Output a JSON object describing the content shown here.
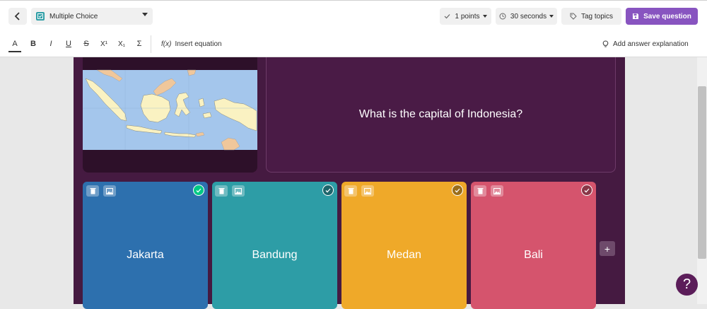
{
  "header": {
    "question_type": "Multiple Choice",
    "points": "1 points",
    "time": "30 seconds",
    "tag_topics": "Tag topics",
    "save": "Save question"
  },
  "toolbar": {
    "items": [
      "A",
      "B",
      "I",
      "U",
      "S",
      "X¹",
      "X₁",
      "Σ"
    ],
    "equation_prefix": "f(x)",
    "insert_equation": "Insert equation",
    "add_explanation": "Add answer explanation"
  },
  "question": {
    "text": "What is the capital of Indonesia?"
  },
  "answers": [
    {
      "label": "Jakarta",
      "color": "#2d70ae",
      "correct": true
    },
    {
      "label": "Bandung",
      "color": "#2d9da6",
      "correct": false
    },
    {
      "label": "Medan",
      "color": "#efa929",
      "correct": false
    },
    {
      "label": "Bali",
      "color": "#d5546d",
      "correct": false
    }
  ],
  "colors": {
    "brand_purple": "#8854c0",
    "canvas": "#451a41",
    "correct_check": "#00c985"
  },
  "help": "?",
  "add_option": "+"
}
